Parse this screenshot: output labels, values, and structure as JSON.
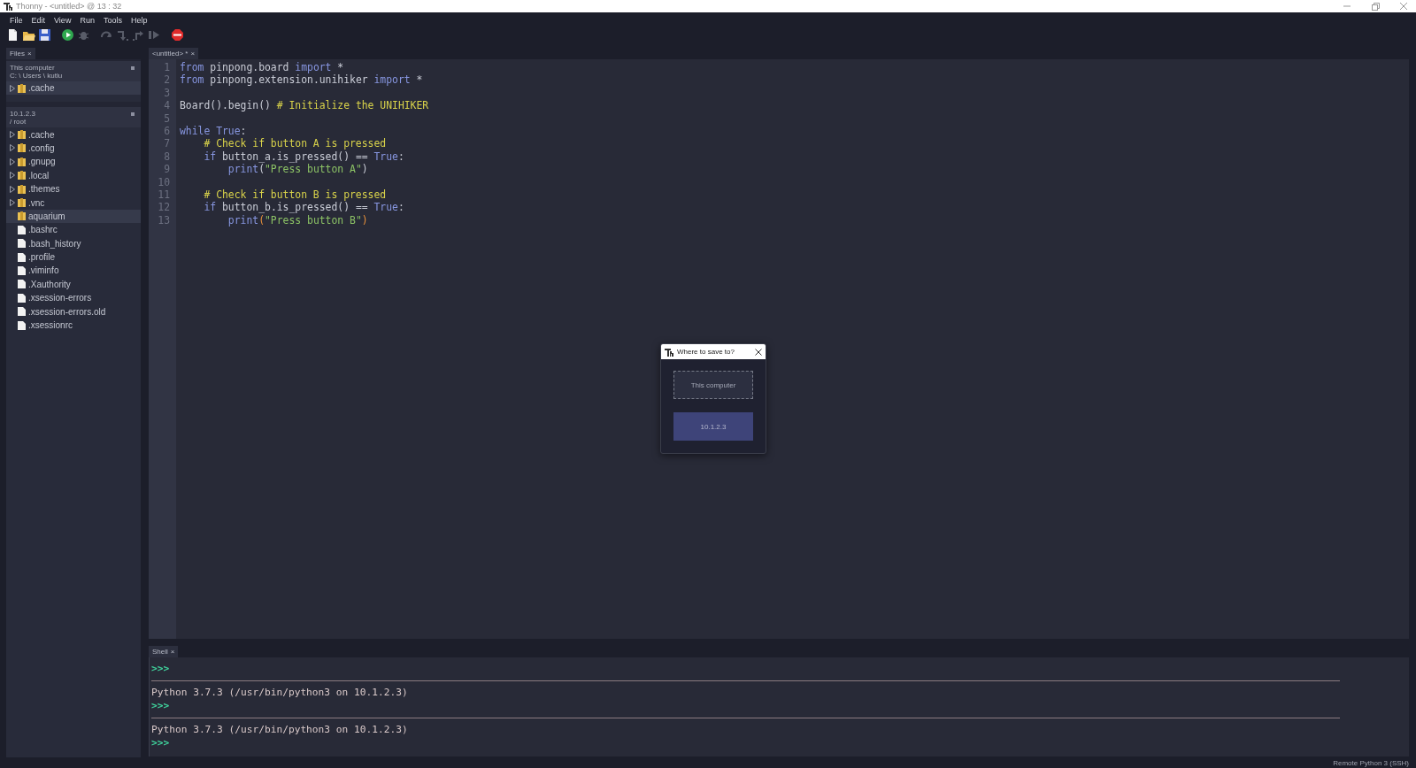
{
  "window": {
    "title": "Thonny  -  <untitled>  @  13 : 32"
  },
  "menu": [
    "File",
    "Edit",
    "View",
    "Run",
    "Tools",
    "Help"
  ],
  "toolbar": [
    {
      "kind": "new",
      "disabled": false
    },
    {
      "kind": "open",
      "disabled": false
    },
    {
      "kind": "save",
      "disabled": false
    },
    {
      "kind": "run",
      "disabled": false
    },
    {
      "kind": "debug",
      "disabled": true
    },
    {
      "kind": "step_over",
      "disabled": true
    },
    {
      "kind": "step_into",
      "disabled": true
    },
    {
      "kind": "step_out",
      "disabled": true
    },
    {
      "kind": "resume",
      "disabled": true
    },
    {
      "kind": "stop",
      "disabled": false
    }
  ],
  "files_panel": {
    "tab": {
      "label": "Files",
      "close": "×"
    },
    "sections": [
      {
        "title": "This computer",
        "path": "C: \\ Users \\ kutlu",
        "items": [
          {
            "name": ".cache",
            "kind": "folder",
            "expandable": true,
            "selected": true
          }
        ]
      },
      {
        "title": "10.1.2.3",
        "path": "/ root",
        "items": [
          {
            "name": ".cache",
            "kind": "folder",
            "expandable": true,
            "selected": false
          },
          {
            "name": ".config",
            "kind": "folder",
            "expandable": true,
            "selected": false
          },
          {
            "name": ".gnupg",
            "kind": "folder",
            "expandable": true,
            "selected": false
          },
          {
            "name": ".local",
            "kind": "folder",
            "expandable": true,
            "selected": false
          },
          {
            "name": ".themes",
            "kind": "folder",
            "expandable": true,
            "selected": false
          },
          {
            "name": ".vnc",
            "kind": "folder",
            "expandable": true,
            "selected": false
          },
          {
            "name": "aquarium",
            "kind": "folder",
            "expandable": false,
            "selected": true
          },
          {
            "name": ".bashrc",
            "kind": "file",
            "expandable": false,
            "selected": false
          },
          {
            "name": ".bash_history",
            "kind": "file",
            "expandable": false,
            "selected": false
          },
          {
            "name": ".profile",
            "kind": "file",
            "expandable": false,
            "selected": false
          },
          {
            "name": ".viminfo",
            "kind": "file",
            "expandable": false,
            "selected": false
          },
          {
            "name": ".Xauthority",
            "kind": "file",
            "expandable": false,
            "selected": false
          },
          {
            "name": ".xsession-errors",
            "kind": "file",
            "expandable": false,
            "selected": false
          },
          {
            "name": ".xsession-errors.old",
            "kind": "file",
            "expandable": false,
            "selected": false
          },
          {
            "name": ".xsessionrc",
            "kind": "file",
            "expandable": false,
            "selected": false
          }
        ]
      }
    ]
  },
  "editor": {
    "tab": {
      "label": "<untitled> *",
      "close": "×"
    },
    "lines": [
      {
        "number": "1",
        "tokens": [
          {
            "text": "from",
            "kind": "keyword"
          },
          {
            "text": " pinpong.board ",
            "kind": "plain"
          },
          {
            "text": "import",
            "kind": "keyword"
          },
          {
            "text": " *",
            "kind": "plain"
          }
        ]
      },
      {
        "number": "2",
        "tokens": [
          {
            "text": "from",
            "kind": "keyword"
          },
          {
            "text": " pinpong.extension.unihiker ",
            "kind": "plain"
          },
          {
            "text": "import",
            "kind": "keyword"
          },
          {
            "text": " *",
            "kind": "plain"
          }
        ]
      },
      {
        "number": "3"
      },
      {
        "number": "4",
        "tokens": [
          {
            "text": "Board().begin() ",
            "kind": "plain"
          },
          {
            "text": "# Initialize the UNIHIKER",
            "kind": "comment"
          }
        ]
      },
      {
        "number": "5"
      },
      {
        "number": "6",
        "tokens": [
          {
            "text": "while True",
            "kind": "keyword"
          },
          {
            "text": ":",
            "kind": "plain"
          }
        ]
      },
      {
        "number": "7",
        "tokens": [
          {
            "text": "    # Check if button A is pressed",
            "kind": "comment"
          }
        ]
      },
      {
        "number": "8",
        "tokens": [
          {
            "text": "    if",
            "kind": "keyword"
          },
          {
            "text": " button_a.is_pressed() == ",
            "kind": "plain"
          },
          {
            "text": "True",
            "kind": "keyword"
          },
          {
            "text": ":",
            "kind": "plain"
          }
        ]
      },
      {
        "number": "9",
        "tokens": [
          {
            "text": "        print",
            "kind": "keyword"
          },
          {
            "text": "(",
            "kind": "plain"
          },
          {
            "text": "\"Press button A\"",
            "kind": "string"
          },
          {
            "text": ")",
            "kind": "plain"
          }
        ]
      },
      {
        "number": "10"
      },
      {
        "number": "11",
        "tokens": [
          {
            "text": "    # Check if button B is pressed",
            "kind": "comment"
          }
        ]
      },
      {
        "number": "12",
        "tokens": [
          {
            "text": "    if",
            "kind": "keyword"
          },
          {
            "text": " button_b.is_pressed() == ",
            "kind": "plain"
          },
          {
            "text": "True",
            "kind": "keyword"
          },
          {
            "text": ":",
            "kind": "plain"
          }
        ]
      },
      {
        "number": "13",
        "tokens": [
          {
            "text": "        print",
            "kind": "keyword"
          },
          {
            "text": "(",
            "kind": "bracket"
          },
          {
            "text": "\"Press button B\"",
            "kind": "string"
          },
          {
            "text": ")",
            "kind": "bracket"
          }
        ]
      }
    ]
  },
  "shell": {
    "tab": {
      "label": "Shell",
      "close": "×"
    },
    "entries": [
      {
        "kind": "prompt",
        "text": ">>>"
      },
      {
        "kind": "separator"
      },
      {
        "kind": "output",
        "text": "Python 3.7.3 (/usr/bin/python3 on 10.1.2.3)"
      },
      {
        "kind": "prompt",
        "text": ">>>"
      },
      {
        "kind": "separator"
      },
      {
        "kind": "output",
        "text": "Python 3.7.3 (/usr/bin/python3 on 10.1.2.3)"
      },
      {
        "kind": "prompt",
        "text": ">>>"
      }
    ]
  },
  "dialog": {
    "title": "Where to save to?",
    "buttons": [
      {
        "label": "This computer",
        "focused": true,
        "highlighted": false
      },
      {
        "label": "10.1.2.3",
        "focused": false,
        "highlighted": true
      }
    ]
  },
  "status_bar": {
    "interpreter": "Remote Python 3 (SSH)"
  }
}
